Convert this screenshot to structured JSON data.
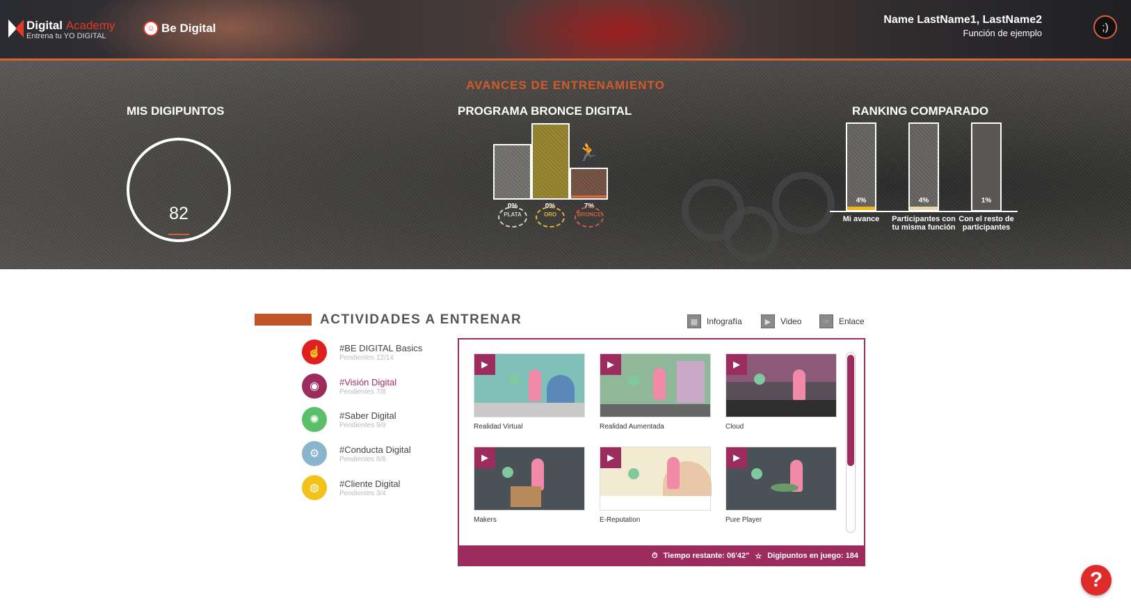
{
  "header": {
    "logo_title": "Digital",
    "logo_title_accent": "Academy",
    "logo_subtitle": "Entrena tu YO DIGITAL",
    "brand_label": "Be Digital",
    "user_name": "Name LastName1, LastName2",
    "user_role": "Función de ejemplo",
    "avatar_text": ";)"
  },
  "stats": {
    "section_title": "AVANCES DE ENTRENAMIENTO",
    "points_title": "MIS DIGIPUNTOS",
    "points_value": "82",
    "program_title": "PROGRAMA BRONCE DIGITAL",
    "medals": [
      {
        "pct": "0%",
        "label": "PLATA",
        "color": "#cfcfcf",
        "fill": 0.55
      },
      {
        "pct": "0%",
        "label": "ORO",
        "color": "#e0b540",
        "fill": 0.75
      },
      {
        "pct": "7%",
        "label": "BRONCE",
        "color": "#c8603a",
        "fill": 0.3
      }
    ],
    "ranking_title": "RANKING COMPARADO",
    "ranking": [
      {
        "pct": "4%",
        "label": "Mi avance",
        "value": 0.04
      },
      {
        "pct": "4%",
        "label": "Participantes con tu misma función",
        "value": 0.04
      },
      {
        "pct": "1%",
        "label": "Con el resto de participantes",
        "value": 0.01
      }
    ]
  },
  "activities": {
    "title": "ACTIVIDADES A ENTRENAR",
    "legend": [
      {
        "label": "Infografía",
        "icon": "infographic-icon"
      },
      {
        "label": "Video",
        "icon": "video-icon"
      },
      {
        "label": "Enlace",
        "icon": "link-icon"
      }
    ],
    "categories": [
      {
        "name": "#BE DIGITAL Basics",
        "pending": "Pendientes 12/14",
        "color": "#e02020",
        "icon": "touch-icon"
      },
      {
        "name": "#Visión Digital",
        "pending": "Pendientes 7/8",
        "color": "#9c2c5e",
        "icon": "eye-icon"
      },
      {
        "name": "#Saber Digital",
        "pending": "Pendientes 9/9",
        "color": "#5bbf6a",
        "icon": "brain-icon"
      },
      {
        "name": "#Conducta Digital",
        "pending": "Pendientes 8/8",
        "color": "#8ab4cc",
        "icon": "people-icon"
      },
      {
        "name": "#Cliente Digital",
        "pending": "Pendientes 3/4",
        "color": "#f2c21a",
        "icon": "globe-icon"
      }
    ],
    "cards": [
      {
        "title": "Realidad Virtual",
        "bg": "#7fc0b8"
      },
      {
        "title": "Realidad Aumentada",
        "bg": "#8fb89a"
      },
      {
        "title": "Cloud",
        "bg": "#5a4e58"
      },
      {
        "title": "Makers",
        "bg": "#4a5258"
      },
      {
        "title": "E-Reputation",
        "bg": "#f3ead2"
      },
      {
        "title": "Pure Player",
        "bg": "#4a5258"
      }
    ],
    "footer": {
      "time": "Tiempo restante: 06'42\"",
      "points": "Digipuntos en juego: 184"
    }
  },
  "help_label": "?"
}
